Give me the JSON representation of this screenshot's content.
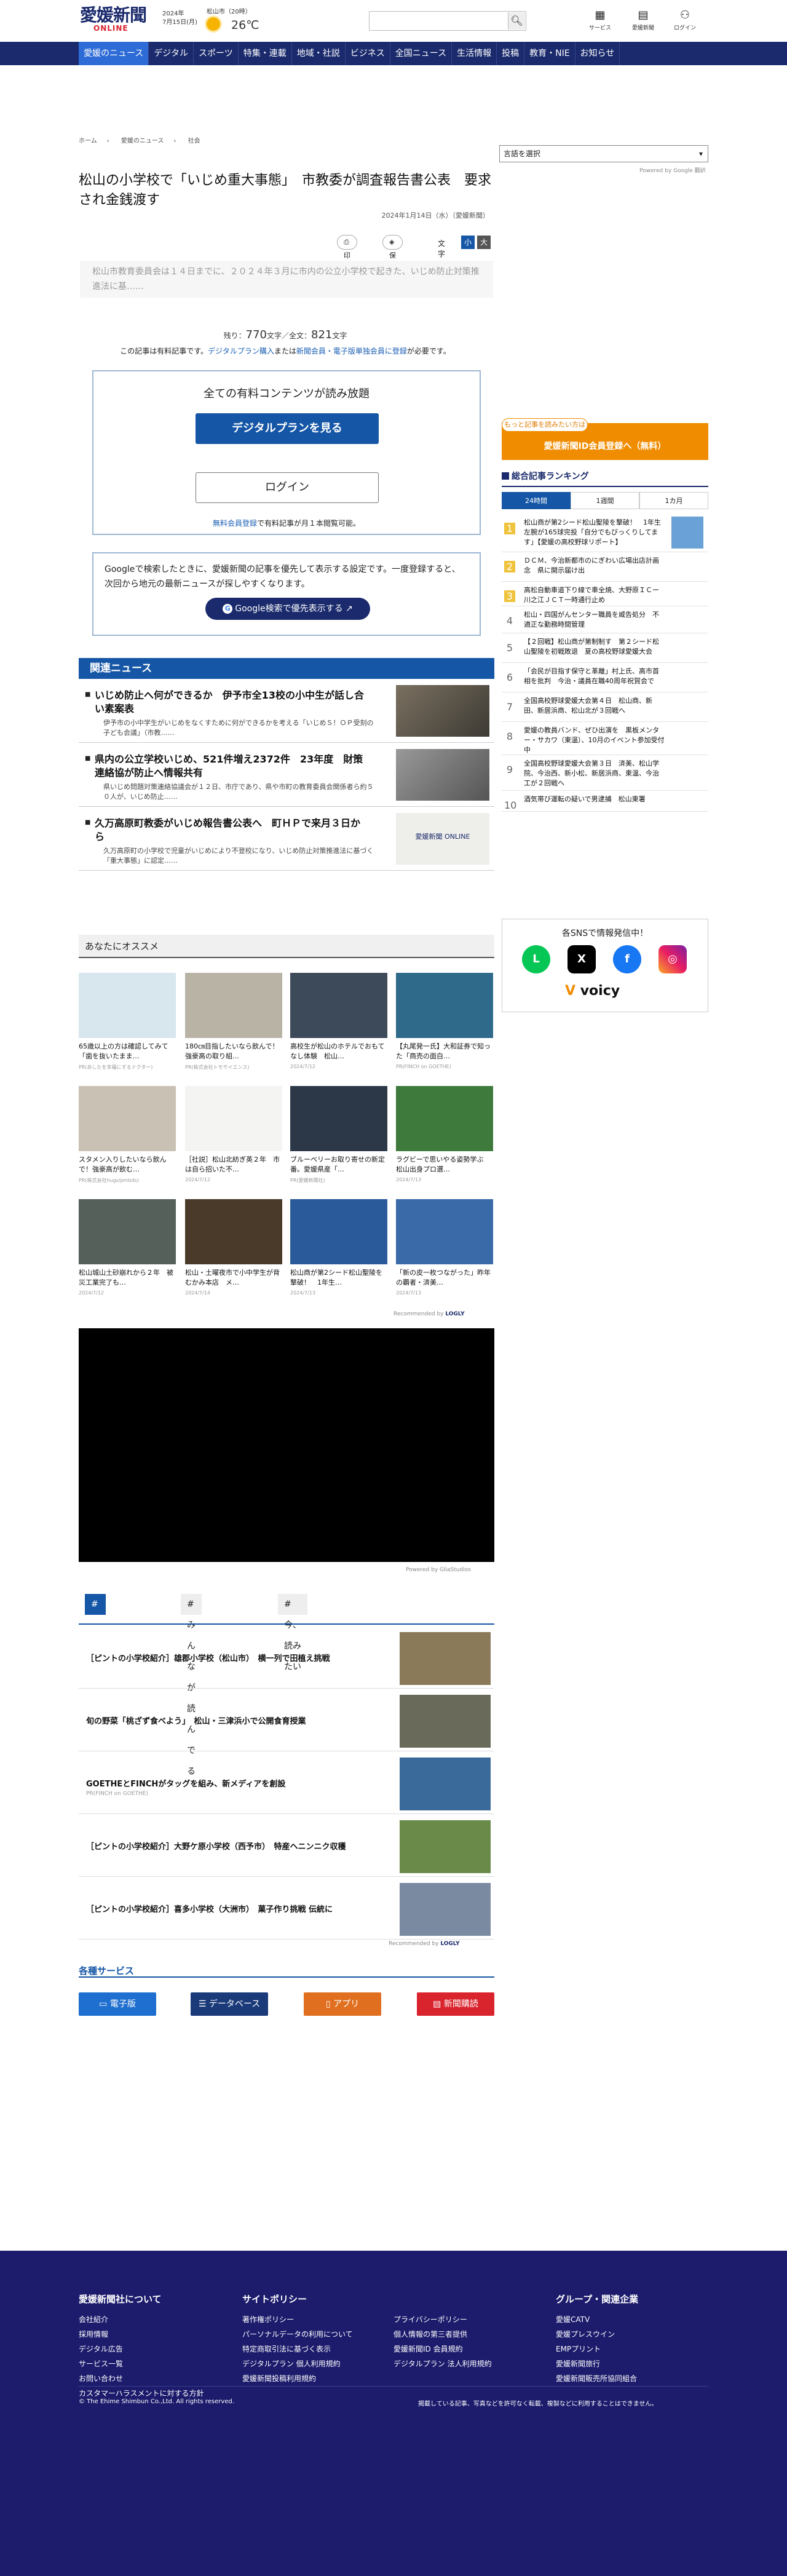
{
  "header": {
    "logo_main": "愛媛新聞",
    "logo_sub": "ONLINE",
    "date_line1": "2024年",
    "date_line2": "7月15日(月)",
    "weather_location": "松山市（20時）",
    "temperature": "26℃",
    "search_placeholder": "",
    "icons": [
      {
        "label": "サービス",
        "icon": "grid-icon"
      },
      {
        "label": "愛媛新聞",
        "icon": "newspaper-icon"
      },
      {
        "label": "ログイン",
        "icon": "user-icon"
      }
    ]
  },
  "nav": {
    "items": [
      "愛媛のニュース",
      "デジタル",
      "スポーツ",
      "特集・連載",
      "地域・社説",
      "ビジネス",
      "全国ニュース",
      "生活情報",
      "投稿",
      "教育・NIE",
      "お知らせ"
    ],
    "active_index": 0,
    "colors": {
      "bar": "#1a2a6c",
      "active": "#2d6bd6"
    }
  },
  "breadcrumb": [
    "ホーム",
    "愛媛のニュース",
    "社会"
  ],
  "article": {
    "title": "松山の小学校で「いじめ重大事態」　市教委が調査報告書公表　要求され金銭渡す",
    "date": "2024年1月14日（水）（愛媛新聞）",
    "tools": {
      "print": "印刷",
      "save": "保存",
      "font_label": "文字",
      "font_small": "小",
      "font_large": "大"
    },
    "lead": "松山市教育委員会は１４日までに、２０２４年３月に市内の公立小学校で起きた、いじめ防止対策推進法に基……",
    "count_prefix": "残り：",
    "count_remaining": "770",
    "count_mid": "文字／全文：",
    "count_total": "821",
    "count_suffix": "文字",
    "notice_pre": "この記事は有料記事です。",
    "notice_link1": "デジタルプラン購入",
    "notice_mid": "または",
    "notice_link2": "新聞会員・電子版単独会員に登録",
    "notice_post": "が必要です。"
  },
  "paywall": {
    "heading": "全ての有料コンテンツが読み放題",
    "plan_button": "デジタルプランを見る",
    "login_button": "ログイン",
    "free_link": "無料会員登録",
    "free_text": "で有料記事が月１本閲覧可能。"
  },
  "google_box": {
    "text": "Googleで検索したときに、愛媛新聞の記事を優先して表示する設定です。一度登録すると、次回から地元の最新ニュースが探しやすくなります。",
    "button": "Google検索で優先表示する"
  },
  "related": {
    "heading": "関連ニュース",
    "items": [
      {
        "title": "いじめ防止へ何ができるか　伊予市全13校の小中生が話し合い素案表",
        "desc": "伊予市の小中学生がいじめをなくすために何ができるかを考える「いじめＳ！ＯＰ受刻の子ども会議」（市教……"
      },
      {
        "title": "県内の公立学校いじめ、521件増え2372件　23年度　財策連絡協が防止へ情報共有",
        "desc": "県いじめ問題対策連絡協議会が１２日、市庁であり、県や市町の教育委員会関係者ら約５０人が、いじめ防止……"
      },
      {
        "title": "久万高原町教委がいじめ報告書公表へ　町ＨＰで来月３日から",
        "desc": "久万高原町の小学校で児童がいじめにより不登校になり、いじめ防止対策推進法に基づく「重大事態」に認定……"
      }
    ]
  },
  "recommend": {
    "heading": "あなたにオススメ",
    "cards": [
      {
        "title": "65歳以上の方は確認してみて「歯を抜いたまま…",
        "source": "PR(あしたを幸福にするドクター)"
      },
      {
        "title": "180㎝目指したいなら飲んで！強豪高の取り組…",
        "source": "PR(株式会社トモサイエンス)"
      },
      {
        "title": "高校生が松山のホテルでおもてなし体験　松山…",
        "source": "2024/7/12"
      },
      {
        "title": "【丸尾発一氏】大和証券で知った「商売の面白…",
        "source": "PR(FINCH on GOETHE)"
      },
      {
        "title": "スタメン入りしたいなら飲んで！強豪高が飲む…",
        "source": "PR(株式会社hugs/pmbds)"
      },
      {
        "title": "［社説］松山北紡ぎ英２年　市は自ら招いた不…",
        "source": "2024/7/12"
      },
      {
        "title": "ブルーベリーお取り寄せの新定番。愛媛県産「…",
        "source": "PR(愛媛新聞社)"
      },
      {
        "title": "ラグビーで思いやる姿勢学ぶ　松山出身プロ選…",
        "source": "2024/7/13"
      },
      {
        "title": "松山城山土砂崩れから２年　被災工業完了も…",
        "source": "2024/7/12"
      },
      {
        "title": "松山・土曜夜市で小中学生が背むかみ本店　メ…",
        "source": "2024/7/14"
      },
      {
        "title": "松山商が第2シード松山聖陵を撃破！　1年生…",
        "source": "2024/7/13"
      },
      {
        "title": "「新の皮一枚つながった」昨年の覇者・済美…",
        "source": "2024/7/13"
      }
    ],
    "recommended_by": "Recommended by",
    "recommended_brand": "LOGLY"
  },
  "video": {
    "powered": "Powered by GliaStudios"
  },
  "tabs": {
    "items": [
      "#あわせて読みたい",
      "#みんなが読んでる",
      "#今、読みたい"
    ],
    "active_index": 0
  },
  "news_rows": [
    {
      "title": "［ピントの小学校紹介］雄郡小学校（松山市）　横一列で田植え挑戦",
      "source": ""
    },
    {
      "title": "旬の野菜「桃ざず食べよう」　松山・三津浜小で公開食育授業",
      "source": ""
    },
    {
      "title": "GOETHEとFINCHがタッグを組み、新メディアを創設",
      "source": "PR(FINCH on GOETHE)"
    },
    {
      "title": "［ピントの小学校紹介］大野ケ原小学校（西予市）　特産ヘニンニク収穫",
      "source": ""
    },
    {
      "title": "［ピントの小学校紹介］喜多小学校（大洲市）　菓子作り挑戦 伝統に",
      "source": ""
    }
  ],
  "services": {
    "heading": "各種サービス",
    "items": [
      {
        "label": "電子版",
        "color": "#1f6fd0"
      },
      {
        "label": "データベース",
        "color": "#1a3a7a"
      },
      {
        "label": "アプリ",
        "color": "#e07020"
      },
      {
        "label": "新聞購読",
        "color": "#d9232d"
      }
    ]
  },
  "sidebar": {
    "lang_select": "言語を選択",
    "lang_powered": "Powered by Google 翻訳",
    "member_tag": "もっと記事を読みたい方は",
    "member_button": "愛媛新聞ID会員登録へ（無料）",
    "ranking_heading": "総合記事ランキング",
    "ranking_tabs": [
      "24時間",
      "1週間",
      "1カ月"
    ],
    "ranking_active": 0,
    "ranking": [
      "松山商が第2シード松山聖陵を撃破！　1年生左腕が165球完投「自分でもびっくりしてます」【愛媛の高校野球リポート】",
      "ＤＣＭ、今治新都市のにぎわい広場出店計画念　県に開示届け出",
      "高松自動車道下り線で車全焼、大野原ＩＣー川之江ＪＣＴ一時通行止め",
      "松山・四国がんセンター職員を威告処分　不適正な勤務時間管理",
      "【２回戦】松山商が第制制す　第２シード松山聖陵を初戦敗退　夏の高校野球愛媛大会",
      "「会民が目指す保守と革離」村上氏、高市首相を批判　今治・議員在職40周年祝賀会で",
      "全国高校野球愛媛大会第４日　松山商、新田、新居浜商、松山北が３回戦へ",
      "愛媛の教員バンド、ぜひ出演を　黒板メンター・サカワ（東温）、10月のイベント参加受付中",
      "全国高校野球愛媛大会第３日　済美、松山学院、今治西、新小松、新居浜商、東温、今治工が２回戦へ",
      "酒気帯び運転の疑いで男逮捕　松山東署"
    ],
    "sns_heading": "各SNSで情報発信中！",
    "sns": [
      "LINE",
      "X",
      "Facebook",
      "Instagram"
    ],
    "sns_voicy": "voicy"
  },
  "footer": {
    "col1_title": "愛媛新聞社について",
    "col1": [
      "会社紹介",
      "採用情報",
      "デジタル広告",
      "サービス一覧",
      "お問い合わせ",
      "カスタマーハラスメントに対する方針"
    ],
    "col2_title": "サイトポリシー",
    "col2": [
      "著作権ポリシー",
      "パーソナルデータの利用について",
      "特定商取引法に基づく表示",
      "デジタルプラン 個人利用規約",
      "愛媛新聞投稿利用規約"
    ],
    "col3": [
      "プライバシーポリシー",
      "個人情報の第三者提供",
      "愛媛新聞ID 会員規約",
      "デジタルプラン 法人利用規約"
    ],
    "col4_title": "グループ・関連企業",
    "col4": [
      "愛媛CATV",
      "愛媛プレスウイン",
      "EMPプリント",
      "愛媛新聞旅行",
      "愛媛新聞販売所協同組合"
    ],
    "copyright": "© The Ehime Shimbun Co.,Ltd. All rights reserved.",
    "copyright_note": "掲載している記事、写真などを許可なく転載、複製などに利用することはできません。",
    "background": "#1c1b6c"
  }
}
